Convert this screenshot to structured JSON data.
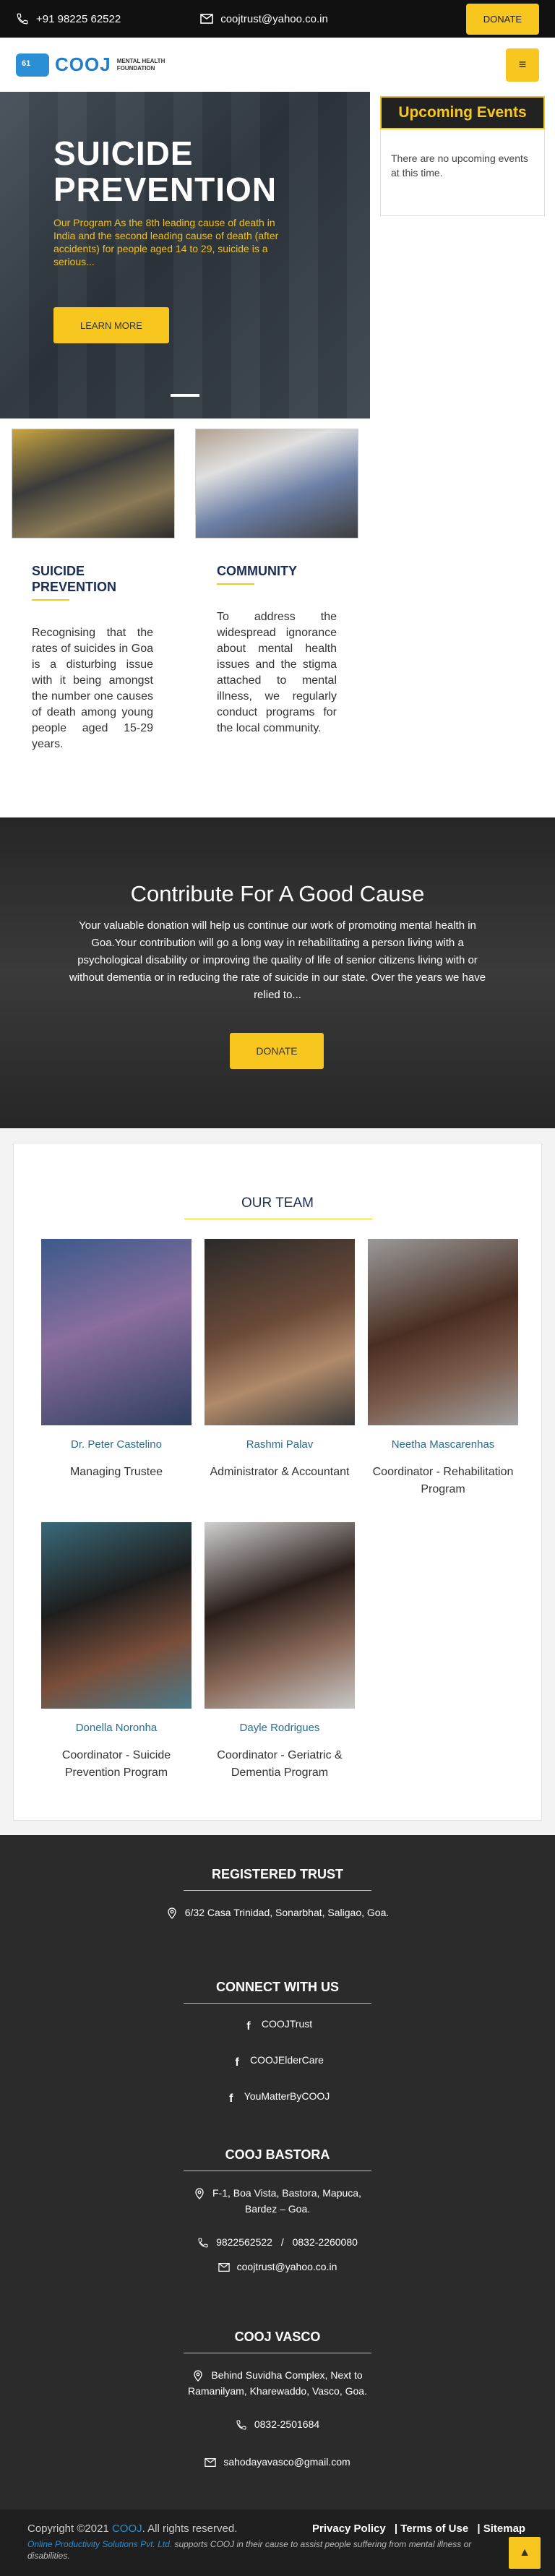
{
  "topbar": {
    "phone": "+91 98225 62522",
    "email": "coojtrust@yahoo.co.in",
    "donate_label": "DONATE"
  },
  "header": {
    "logo_text": "COOJ",
    "logo_mark": "61",
    "logo_subtitle_1": "MENTAL HEALTH",
    "logo_subtitle_2": "FOUNDATION",
    "menu_icon": "hamburger-icon"
  },
  "hero": {
    "title_line1": "SUICIDE",
    "title_line2": "PREVENTION",
    "text": "Our Program As the 8th leading cause of death in India and the second leading cause of death (after accidents) for people aged 14 to 29, suicide is a serious...",
    "button_label": "LEARN MORE"
  },
  "events": {
    "title": "Upcoming Events",
    "empty_text": "There are no upcoming events at this time."
  },
  "programs": [
    {
      "title_line1": "SUICIDE",
      "title_line2": "PREVENTION",
      "text": "Recognising that the rates of suicides in Goa is a disturbing issue with it being amongst the number one causes of death among young people aged 15-29 years."
    },
    {
      "title_line1": "COMMUNITY",
      "title_line2": "",
      "text": "To address the widespread ignorance about mental health issues and the stigma attached to mental illness, we regularly conduct programs for the local community."
    }
  ],
  "contribute": {
    "title": "Contribute For A Good Cause",
    "text": "Your valuable donation will help us continue our work of promoting mental health in Goa.Your contribution will go a long way in rehabilitating a person living with a psychological disability or improving the quality of life of senior citizens living with or without dementia or in reducing the rate of suicide in our state. Over the years we have relied to...",
    "button_label": "DONATE"
  },
  "team": {
    "title": "OUR TEAM",
    "members": [
      {
        "name": "Dr. Peter Castelino",
        "role": "Managing Trustee"
      },
      {
        "name": "Rashmi Palav",
        "role": "Administrator & Accountant"
      },
      {
        "name": "Neetha Mascarenhas",
        "role": "Coordinator - Rehabilitation Program"
      },
      {
        "name": "Donella Noronha",
        "role": "Coordinator - Suicide Prevention Program"
      },
      {
        "name": "Dayle Rodrigues",
        "role": "Coordinator - Geriatric & Dementia Program"
      }
    ]
  },
  "footer": {
    "registered_title": "REGISTERED TRUST",
    "registered_address": "6/32 Casa Trinidad, Sonarbhat, Saligao, Goa.",
    "connect_title": "CONNECT WITH US",
    "social": [
      "COOJTrust",
      "COOJElderCare",
      "YouMatterByCOOJ"
    ],
    "bastora_title": "COOJ BASTORA",
    "bastora_address_1": "F-1, Boa Vista, Bastora, Mapuca,",
    "bastora_address_2": "Bardez – Goa.",
    "bastora_phone_1": "9822562522",
    "bastora_phone_sep": "/",
    "bastora_phone_2": "0832-2260080",
    "bastora_email": "coojtrust@yahoo.co.in",
    "vasco_title": "COOJ VASCO",
    "vasco_address_1": "Behind Suvidha Complex, Next to",
    "vasco_address_2": "Ramanilyam, Kharewaddo, Vasco, Goa.",
    "vasco_phone": "0832-2501684",
    "vasco_email": "sahodayavasco@gmail.com"
  },
  "bottombar": {
    "copy_prefix": "Copyright ©2021",
    "copy_brand": "COOJ",
    "copy_suffix": ". All rights reserved.",
    "link_privacy": "Privacy Policy",
    "link_terms": "| Terms of Use",
    "link_sitemap": "| Sitemap",
    "note_link": "Online Productivity Solutions Pvt. Ltd.",
    "note_text": " supports COOJ in their cause to assist people suffering from mental illness or disabilities.",
    "back_to_top_icon": "chevron-up-icon"
  },
  "colors": {
    "accent": "#f7c720",
    "navy": "#1b2d55",
    "brand_blue": "#2a8fd4"
  }
}
